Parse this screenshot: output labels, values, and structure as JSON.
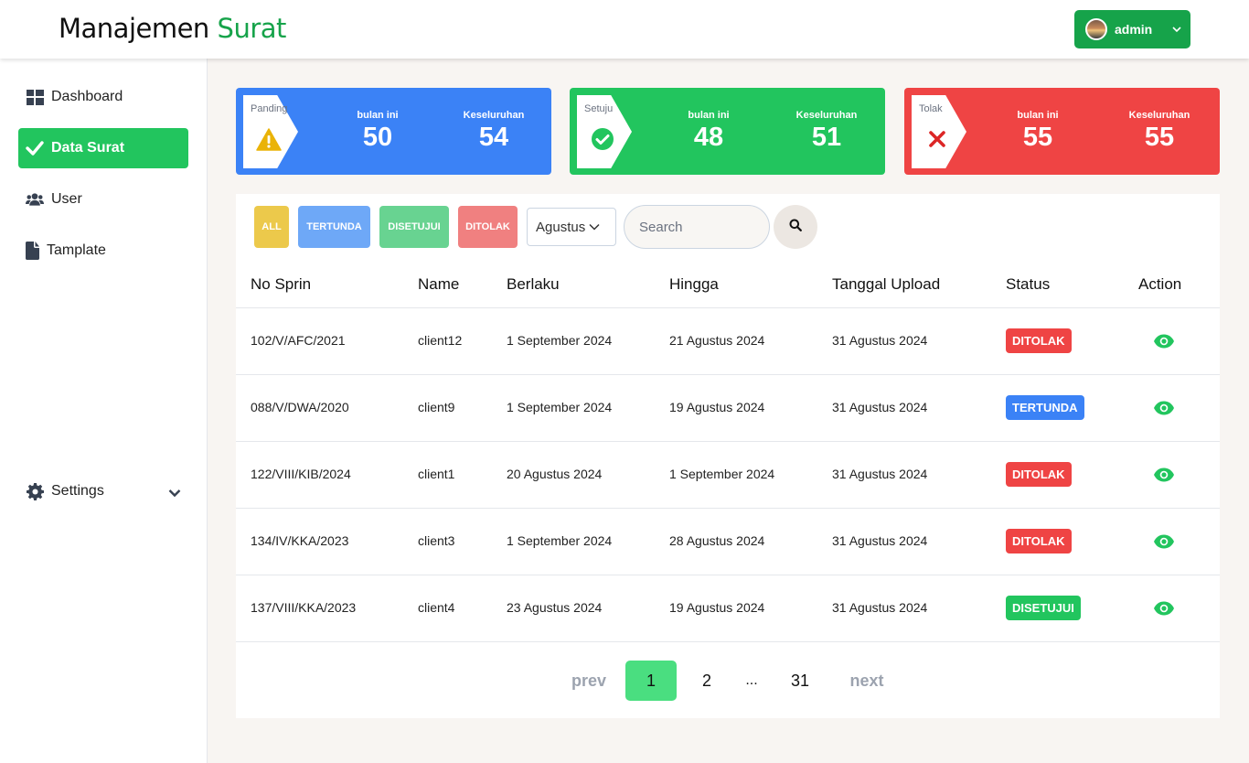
{
  "header": {
    "brand_main": "Manajemen",
    "brand_accent": "Surat",
    "user_name": "admin"
  },
  "sidebar": {
    "items": [
      {
        "label": "Dashboard",
        "icon": "grid-icon"
      },
      {
        "label": "Data Surat",
        "icon": "check-icon",
        "active": true
      },
      {
        "label": "User",
        "icon": "users-icon"
      },
      {
        "label": "Tamplate",
        "icon": "file-icon"
      }
    ],
    "settings_label": "Settings"
  },
  "cards": [
    {
      "tab": "Panding",
      "month_label": "bulan ini",
      "month_value": "50",
      "total_label": "Keseluruhan",
      "total_value": "54",
      "color": "#3b82f6",
      "icon": "warning-icon"
    },
    {
      "tab": "Setuju",
      "month_label": "bulan ini",
      "month_value": "48",
      "total_label": "Keseluruhan",
      "total_value": "51",
      "color": "#22c55e",
      "icon": "check-circle-icon"
    },
    {
      "tab": "Tolak",
      "month_label": "bulan ini",
      "month_value": "55",
      "total_label": "Keseluruhan",
      "total_value": "55",
      "color": "#ef4444",
      "icon": "x-icon"
    }
  ],
  "filters": {
    "all": "ALL",
    "pending": "TERTUNDA",
    "approved": "DISETUJUI",
    "rejected": "DITOLAK",
    "month": "Agustus",
    "search_placeholder": "Search"
  },
  "table": {
    "headers": [
      "No Sprin",
      "Name",
      "Berlaku",
      "Hingga",
      "Tanggal Upload",
      "Status",
      "Action"
    ],
    "rows": [
      {
        "no": "102/V/AFC/2021",
        "name": "client12",
        "berlaku": "1 September 2024",
        "hingga": "21 Agustus 2024",
        "upload": "31 Agustus 2024",
        "status": "DITOLAK"
      },
      {
        "no": "088/V/DWA/2020",
        "name": "client9",
        "berlaku": "1 September 2024",
        "hingga": "19 Agustus 2024",
        "upload": "31 Agustus 2024",
        "status": "TERTUNDA"
      },
      {
        "no": "122/VIII/KIB/2024",
        "name": "client1",
        "berlaku": "20 Agustus 2024",
        "hingga": "1 September 2024",
        "upload": "31 Agustus 2024",
        "status": "DITOLAK"
      },
      {
        "no": "134/IV/KKA/2023",
        "name": "client3",
        "berlaku": "1 September 2024",
        "hingga": "28 Agustus 2024",
        "upload": "31 Agustus 2024",
        "status": "DITOLAK"
      },
      {
        "no": "137/VIII/KKA/2023",
        "name": "client4",
        "berlaku": "23 Agustus 2024",
        "hingga": "19 Agustus 2024",
        "upload": "31 Agustus 2024",
        "status": "DISETUJUI"
      }
    ]
  },
  "status_colors": {
    "DITOLAK": "#ef4444",
    "TERTUNDA": "#3b82f6",
    "DISETUJUI": "#22c55e"
  },
  "pagination": {
    "prev": "prev",
    "current": "1",
    "page2": "2",
    "ellipsis": "...",
    "last": "31",
    "next": "next"
  }
}
